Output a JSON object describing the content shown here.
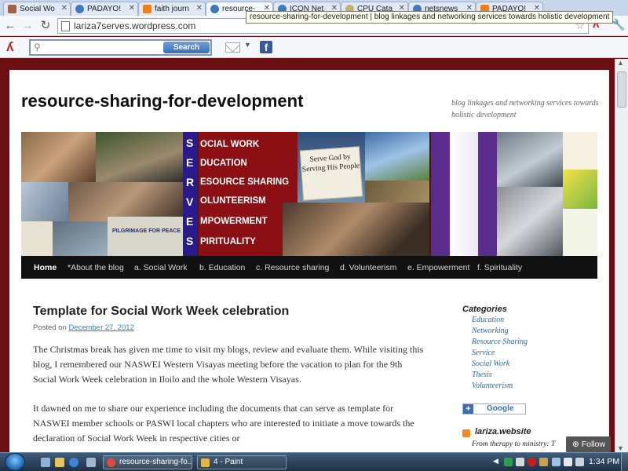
{
  "browser": {
    "tabs": [
      {
        "label": "Social Wo",
        "icon": "photo-favicon-icon"
      },
      {
        "label": "PADAYO!",
        "icon": "wordpress-icon"
      },
      {
        "label": "faith journ",
        "icon": "blogger-icon"
      },
      {
        "label": "resource-",
        "icon": "wordpress-icon",
        "active": true
      },
      {
        "label": "ICON Net",
        "icon": "wordpress-icon"
      },
      {
        "label": "CPU Cata",
        "icon": "cpu-icon"
      },
      {
        "label": "netsnews",
        "icon": "wordpress-icon"
      },
      {
        "label": "PADAYO!",
        "icon": "blogger-icon"
      }
    ],
    "tooltip": "resource-sharing-for-development | blog linkages and networking services towards holistic development",
    "url": "lariza7serves.wordpress.com",
    "toolbar": {
      "search_button": "Search"
    }
  },
  "site": {
    "title": "resource-sharing-for-development",
    "description": "blog linkages and networking services towards holistic development",
    "banner": {
      "serves_letters": [
        "S",
        "E",
        "R",
        "V",
        "E",
        "S"
      ],
      "serves_words": [
        "OCIAL WORK",
        "DUCATION",
        "ESOURCE SHARING",
        "OLUNTEERISM",
        "MPOWERMENT",
        "PIRITUALITY"
      ],
      "sign_text": "Serve God by Serving His People",
      "banner_text": "PILGRIMAGE FOR PEACE"
    },
    "menu": [
      "Home",
      "*About the blog",
      "a. Social Work",
      "b. Education",
      "c. Resource sharing",
      "d. Volunteerism",
      "e. Empowerment",
      "f. Spirituality"
    ]
  },
  "post": {
    "title": "Template for Social Work Week celebration",
    "posted_on": "Posted on",
    "date": "December 27, 2012",
    "paragraphs": [
      "The Christmas break has given me time to visit my blogs, review and evaluate them. While visiting this blog, I remembered our NASWEI Western Visayas meeting before the vacation to plan for the 9th Social Work Week celebration in Iloilo and the whole Western Visayas.",
      "It dawned on me to share our experience including the documents that can serve as template for  NASWEI member schools or PASWI local chapters who are interested to initiate a move towards the declaration of Social Work Week in respective cities or"
    ]
  },
  "sidebar": {
    "categories_title": "Categories",
    "categories": [
      "Education",
      "Networking",
      "Resource Sharing",
      "Service",
      "Social Work",
      "Thesis",
      "Volunteerism"
    ],
    "google_button": "Google",
    "rss_title": "lariza.website",
    "rss_item": "From therapy to ministry: T"
  },
  "follow_button": "Follow",
  "taskbar": {
    "tasks": [
      "resource-sharing-fo...",
      "4 - Paint"
    ],
    "clock": "1:34 PM"
  },
  "colors": {
    "page_background": "#6b0f12",
    "menu_background": "#111111",
    "link": "#1b6ab0",
    "date_link": "#1b8be0"
  }
}
